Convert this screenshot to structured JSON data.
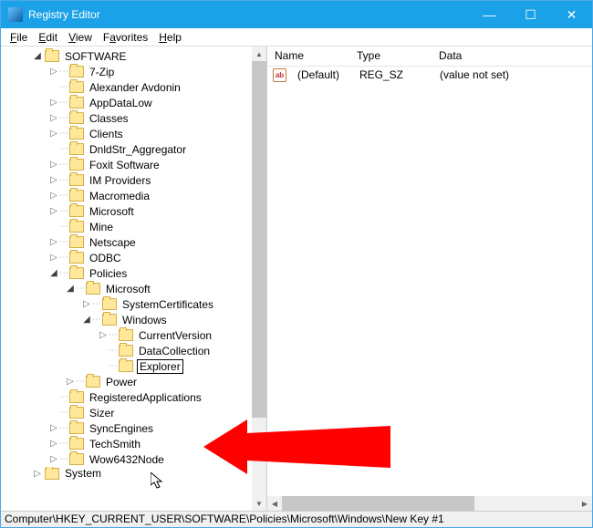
{
  "window": {
    "title": "Registry Editor",
    "minimize": "—",
    "maximize": "☐",
    "close": "✕"
  },
  "menu": {
    "file": "File",
    "edit": "Edit",
    "view": "View",
    "favorites": "Favorites",
    "help": "Help"
  },
  "tree": {
    "root": "SOFTWARE",
    "items": [
      {
        "label": "7-Zip",
        "toggle": ">",
        "indent": 1
      },
      {
        "label": "Alexander Avdonin",
        "toggle": "",
        "indent": 1
      },
      {
        "label": "AppDataLow",
        "toggle": ">",
        "indent": 1
      },
      {
        "label": "Classes",
        "toggle": ">",
        "indent": 1
      },
      {
        "label": "Clients",
        "toggle": ">",
        "indent": 1
      },
      {
        "label": "DnldStr_Aggregator",
        "toggle": "",
        "indent": 1
      },
      {
        "label": "Foxit Software",
        "toggle": ">",
        "indent": 1
      },
      {
        "label": "IM Providers",
        "toggle": ">",
        "indent": 1
      },
      {
        "label": "Macromedia",
        "toggle": ">",
        "indent": 1
      },
      {
        "label": "Microsoft",
        "toggle": ">",
        "indent": 1
      },
      {
        "label": "Mine",
        "toggle": "",
        "indent": 1
      },
      {
        "label": "Netscape",
        "toggle": ">",
        "indent": 1
      },
      {
        "label": "ODBC",
        "toggle": ">",
        "indent": 1
      },
      {
        "label": "Policies",
        "toggle": "v",
        "indent": 1
      },
      {
        "label": "Microsoft",
        "toggle": "v",
        "indent": 2
      },
      {
        "label": "SystemCertificates",
        "toggle": ">",
        "indent": 3
      },
      {
        "label": "Windows",
        "toggle": "v",
        "indent": 3
      },
      {
        "label": "CurrentVersion",
        "toggle": ">",
        "indent": 4
      },
      {
        "label": "DataCollection",
        "toggle": "",
        "indent": 4
      },
      {
        "label": "Explorer",
        "toggle": "",
        "indent": 4,
        "editing": true
      },
      {
        "label": "Power",
        "toggle": ">",
        "indent": 2
      },
      {
        "label": "RegisteredApplications",
        "toggle": "",
        "indent": 1
      },
      {
        "label": "Sizer",
        "toggle": "",
        "indent": 1
      },
      {
        "label": "SyncEngines",
        "toggle": ">",
        "indent": 1
      },
      {
        "label": "TechSmith",
        "toggle": ">",
        "indent": 1
      },
      {
        "label": "Wow6432Node",
        "toggle": ">",
        "indent": 1
      }
    ],
    "after": "System"
  },
  "list": {
    "cols": {
      "name": "Name",
      "type": "Type",
      "data": "Data"
    },
    "widths": {
      "name": 90,
      "type": 90,
      "data": 150
    },
    "row": {
      "name": "(Default)",
      "type": "REG_SZ",
      "data": "(value not set)",
      "icon": "ab"
    }
  },
  "statusbar": {
    "path": "Computer\\HKEY_CURRENT_USER\\SOFTWARE\\Policies\\Microsoft\\Windows\\New Key #1"
  },
  "annotation": {
    "arrow_color": "#ff0000"
  }
}
